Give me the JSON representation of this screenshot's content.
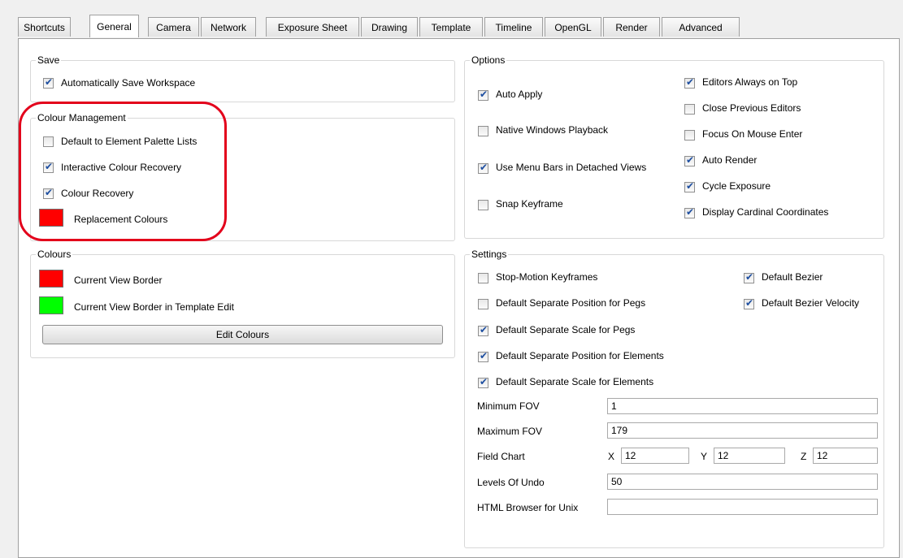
{
  "tabs": [
    "Shortcuts",
    "General",
    "Camera",
    "Network",
    "Exposure Sheet",
    "Drawing",
    "Template",
    "Timeline",
    "OpenGL",
    "Render",
    "Advanced"
  ],
  "active_tab": "General",
  "save": {
    "title": "Save",
    "auto_save": {
      "label": "Automatically Save Workspace",
      "checked": true
    }
  },
  "colour_management": {
    "title": "Colour Management",
    "default_palette": {
      "label": "Default to Element Palette Lists",
      "checked": false
    },
    "interactive_recovery": {
      "label": "Interactive Colour Recovery",
      "checked": true
    },
    "colour_recovery": {
      "label": "Colour Recovery",
      "checked": true
    },
    "replacement": {
      "label": "Replacement Colours",
      "color": "#ff0000"
    }
  },
  "colours": {
    "title": "Colours",
    "view_border": {
      "label": "Current View Border",
      "color": "#ff0000"
    },
    "template_border": {
      "label": "Current View Border in Template Edit",
      "color": "#00ff00"
    },
    "edit_button": "Edit Colours"
  },
  "options": {
    "title": "Options",
    "auto_apply": {
      "label": "Auto Apply",
      "checked": true
    },
    "native_playback": {
      "label": "Native Windows Playback",
      "checked": false
    },
    "menu_bars": {
      "label": "Use Menu Bars in Detached Views",
      "checked": true
    },
    "snap_keyframe": {
      "label": "Snap Keyframe",
      "checked": false
    },
    "editors_top": {
      "label": "Editors Always on Top",
      "checked": true
    },
    "close_editors": {
      "label": "Close Previous Editors",
      "checked": false
    },
    "focus_mouse": {
      "label": "Focus On Mouse Enter",
      "checked": false
    },
    "auto_render": {
      "label": "Auto Render",
      "checked": true
    },
    "cycle_exposure": {
      "label": "Cycle Exposure",
      "checked": true
    },
    "cardinal": {
      "label": "Display Cardinal Coordinates",
      "checked": true
    }
  },
  "settings": {
    "title": "Settings",
    "stop_motion": {
      "label": "Stop-Motion Keyframes",
      "checked": false
    },
    "sep_pos_pegs": {
      "label": "Default Separate Position for Pegs",
      "checked": false
    },
    "sep_scale_pegs": {
      "label": "Default Separate Scale for Pegs",
      "checked": true
    },
    "sep_pos_elements": {
      "label": "Default Separate Position for Elements",
      "checked": true
    },
    "sep_scale_elements": {
      "label": "Default Separate Scale for Elements",
      "checked": true
    },
    "default_bezier": {
      "label": "Default Bezier",
      "checked": true
    },
    "bezier_velocity": {
      "label": "Default Bezier Velocity",
      "checked": true
    },
    "min_fov": {
      "label": "Minimum FOV",
      "value": "1"
    },
    "max_fov": {
      "label": "Maximum FOV",
      "value": "179"
    },
    "field_chart": {
      "label": "Field Chart",
      "x_label": "X",
      "x": "12",
      "y_label": "Y",
      "y": "12",
      "z_label": "Z",
      "z": "12"
    },
    "undo": {
      "label": "Levels Of Undo",
      "value": "50"
    },
    "html_browser": {
      "label": "HTML Browser for Unix",
      "value": ""
    }
  },
  "accent_highlight_color": "#e3001b"
}
